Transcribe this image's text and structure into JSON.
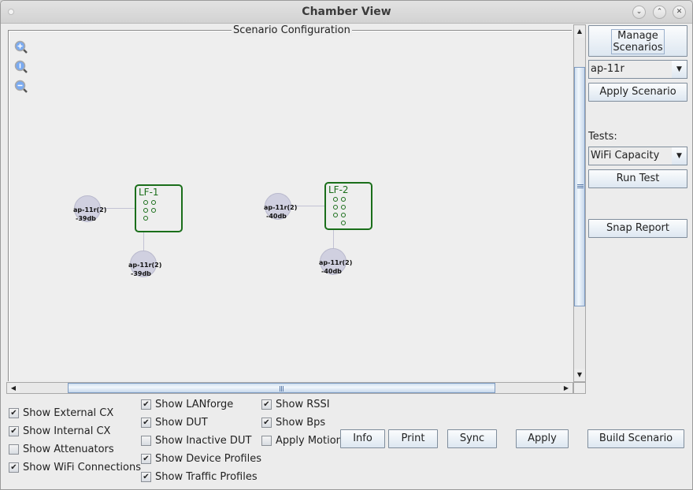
{
  "window": {
    "title": "Chamber View",
    "controls": {
      "minimize": "⌄",
      "maximize": "⌃",
      "close": "✕"
    }
  },
  "scenario": {
    "legend": "Scenario Configuration",
    "zoom_tools": [
      {
        "name": "zoom-in-icon",
        "glyph": "+"
      },
      {
        "name": "zoom-reset-icon",
        "glyph": "1"
      },
      {
        "name": "zoom-out-icon",
        "glyph": "−"
      }
    ],
    "lanforge": [
      {
        "label": "LF-1",
        "ports": 5
      },
      {
        "label": "LF-2",
        "ports": 7
      }
    ],
    "duts": [
      {
        "name": "ap-11r(2)",
        "rssi": "-39db"
      },
      {
        "name": "ap-11r(2)",
        "rssi": "-39db"
      },
      {
        "name": "ap-11r(2)",
        "rssi": "-40db"
      },
      {
        "name": "ap-11r(2)",
        "rssi": "-40db"
      }
    ]
  },
  "sidebar": {
    "manage_line1": "Manage",
    "manage_line2": "Scenarios",
    "scenario_select": "ap-11r",
    "apply_scenario": "Apply Scenario",
    "tests_label": "Tests:",
    "tests_select": "WiFi Capacity",
    "run_test": "Run Test",
    "snap_report": "Snap Report"
  },
  "options": {
    "col1": [
      {
        "label": "Show External CX",
        "checked": true
      },
      {
        "label": "Show Internal CX",
        "checked": true
      },
      {
        "label": "Show Attenuators",
        "checked": false
      },
      {
        "label": "Show WiFi Connections",
        "checked": true
      }
    ],
    "col2": [
      {
        "label": "Show LANforge",
        "checked": true
      },
      {
        "label": "Show DUT",
        "checked": true
      },
      {
        "label": "Show Inactive DUT",
        "checked": false
      },
      {
        "label": "Show Device Profiles",
        "checked": true
      },
      {
        "label": "Show Traffic Profiles",
        "checked": true
      }
    ],
    "col3": [
      {
        "label": "Show RSSI",
        "checked": true
      },
      {
        "label": "Show Bps",
        "checked": true
      },
      {
        "label": "Apply Motion",
        "checked": false
      }
    ]
  },
  "buttons": {
    "info": "Info",
    "print": "Print",
    "sync": "Sync",
    "apply": "Apply",
    "build_scenario": "Build Scenario"
  },
  "scrollbars": {
    "vertical": {
      "up": "▲",
      "down": "▼"
    },
    "horizontal": {
      "left": "◀",
      "right": "▶"
    }
  }
}
